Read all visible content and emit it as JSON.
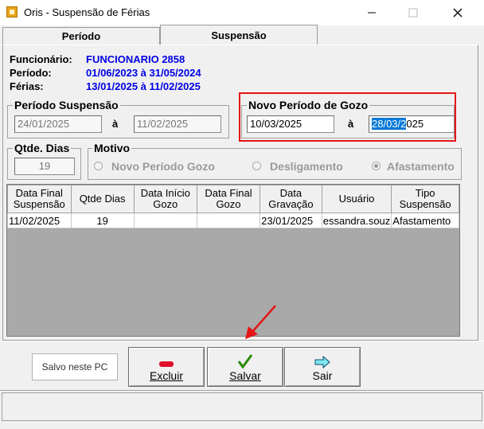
{
  "window": {
    "title": "Oris - Suspensão de Férias",
    "min": "—",
    "max": "☐",
    "close": "✕"
  },
  "tabs": [
    {
      "label": "Período"
    },
    {
      "label": "Suspensão"
    }
  ],
  "info": {
    "funcionario_label": "Funcionário:",
    "funcionario_value": "FUNCIONARIO 2858",
    "periodo_label": "Período:",
    "periodo_value": "01/06/2023 à 31/05/2024",
    "ferias_label": "Férias:",
    "ferias_value": "13/01/2025 à 11/02/2025"
  },
  "periodo_suspensao": {
    "title": "Período Suspensão",
    "start": "24/01/2025",
    "sep": "à",
    "end": "11/02/2025"
  },
  "novo_periodo": {
    "title": "Novo Período de Gozo",
    "start": "10/03/2025",
    "sep": "à",
    "end_selected": "28/03/2",
    "end_rest": "025"
  },
  "qtde_dias": {
    "title": "Qtde. Dias",
    "value": "19"
  },
  "motivo": {
    "title": "Motivo",
    "options": [
      "Novo Período Gozo",
      "Desligamento",
      "Afastamento"
    ],
    "selected": "Afastamento"
  },
  "table": {
    "headers": [
      "Data Final Suspensão",
      "Qtde Dias",
      "Data Início Gozo",
      "Data Final Gozo",
      "Data Gravação",
      "Usuário",
      "Tipo Suspensão"
    ],
    "rows": [
      [
        "11/02/2025",
        "19",
        "",
        "",
        "23/01/2025",
        "essandra.souz",
        "Afastamento"
      ]
    ]
  },
  "status_box": "Salvo neste PC",
  "buttons": {
    "excluir": "Excluir",
    "salvar": "Salvar",
    "sair": "Sair"
  },
  "colors": {
    "highlight_box": "#e51616",
    "arrow": "#e51616",
    "value_blue": "#0000e6",
    "selection": "#0078d7"
  }
}
